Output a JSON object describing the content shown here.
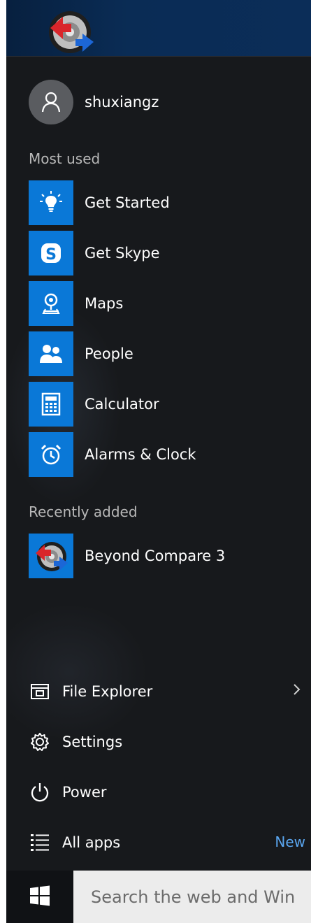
{
  "desktop": {
    "icon": "beyond-compare-icon"
  },
  "user": {
    "name": "shuxiangz",
    "avatar_icon": "person-icon"
  },
  "most_used": {
    "label": "Most used",
    "items": [
      {
        "label": "Get Started",
        "icon": "lightbulb-icon"
      },
      {
        "label": "Get Skype",
        "icon": "skype-icon"
      },
      {
        "label": "Maps",
        "icon": "maps-icon"
      },
      {
        "label": "People",
        "icon": "people-icon"
      },
      {
        "label": "Calculator",
        "icon": "calculator-icon"
      },
      {
        "label": "Alarms & Clock",
        "icon": "alarm-clock-icon"
      }
    ]
  },
  "recently_added": {
    "label": "Recently added",
    "items": [
      {
        "label": "Beyond Compare 3",
        "icon": "beyond-compare-icon"
      }
    ]
  },
  "bottom": {
    "file_explorer": "File Explorer",
    "settings": "Settings",
    "power": "Power",
    "all_apps": "All apps",
    "new_badge": "New"
  },
  "taskbar": {
    "start_icon": "windows-logo-icon",
    "search_placeholder": "Search the web and Win"
  },
  "colors": {
    "tile_blue": "#0a78d7",
    "menu_bg": "#17191c",
    "new_badge": "#5aa6f0"
  }
}
